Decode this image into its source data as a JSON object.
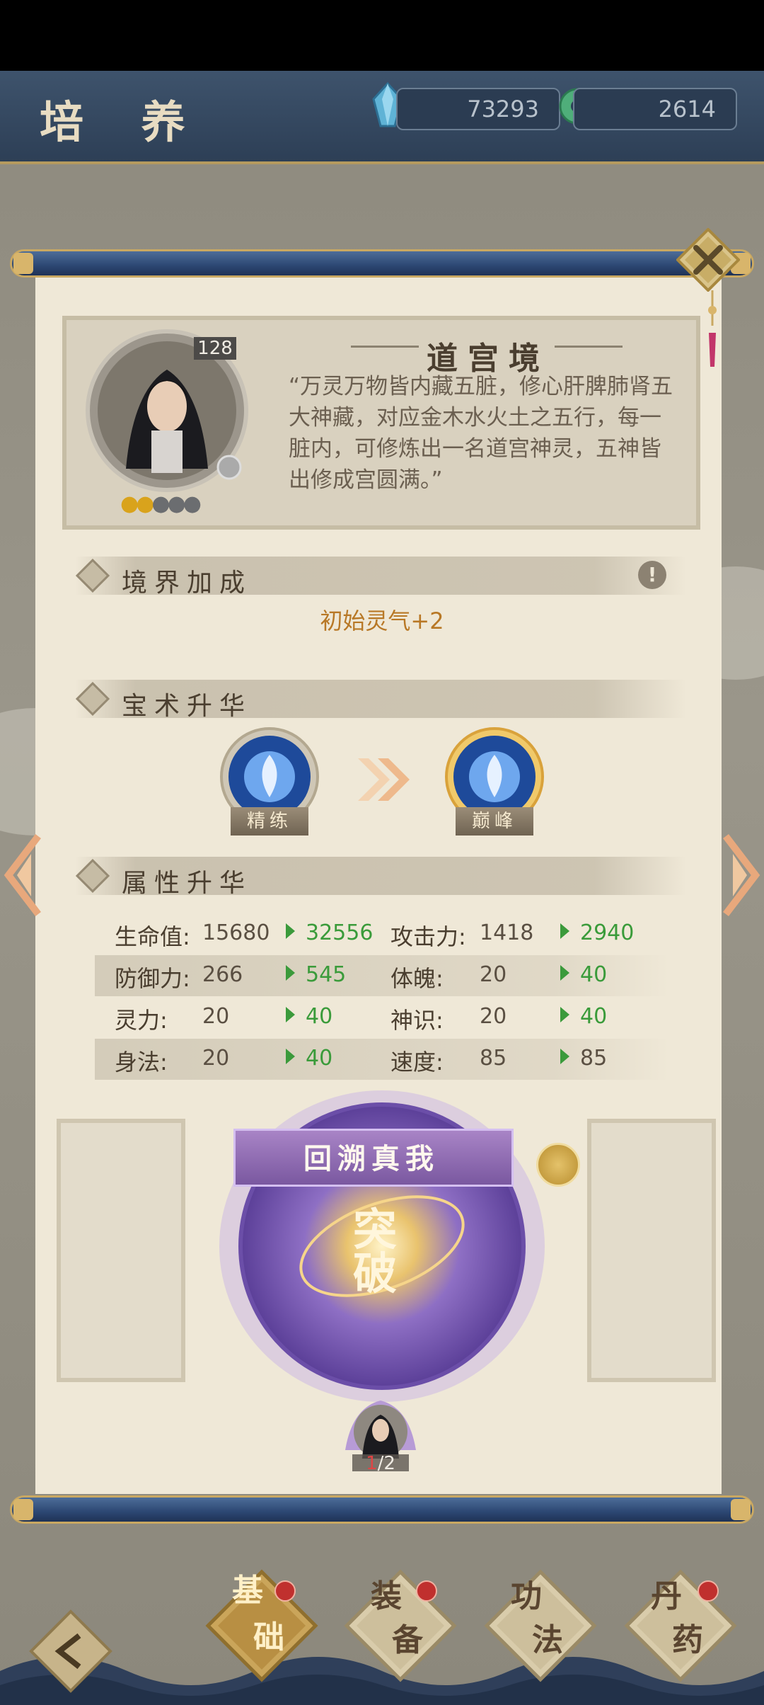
{
  "header": {
    "title": "培 养",
    "spirit_stones": "73293",
    "jade": "2614"
  },
  "hero": {
    "level": "128",
    "stars_total": 5,
    "stars_gold": 2
  },
  "realm": {
    "title": "道宫境",
    "description": "“万灵万物皆内藏五脏，修心肝脾肺肾五大神藏，对应金木水火土之五行，每一脏内，可修炼出一名道宫神灵，五神皆出修成宫圆满。”"
  },
  "sections": {
    "realm_bonus": "境界加成",
    "skill_upgrade": "宝术升华",
    "attr_upgrade": "属性升华"
  },
  "bonus_text": "初始灵气+2",
  "skills": {
    "current_tag": "精练",
    "next_tag": "巅峰"
  },
  "stats": [
    {
      "left_name": "生命值:",
      "left_val": "15680",
      "left_new": "32556",
      "right_name": "攻击力:",
      "right_val": "1418",
      "right_new": "2940"
    },
    {
      "left_name": "防御力:",
      "left_val": "266",
      "left_new": "545",
      "right_name": "体魄:",
      "right_val": "20",
      "right_new": "40"
    },
    {
      "left_name": "灵力:",
      "left_val": "20",
      "left_new": "40",
      "right_name": "神识:",
      "right_val": "20",
      "right_new": "40"
    },
    {
      "left_name": "身法:",
      "left_val": "20",
      "left_new": "40",
      "right_name": "速度:",
      "right_val": "85",
      "right_new": "85"
    }
  ],
  "breakthrough": {
    "banner": "回溯真我",
    "action": "突破",
    "progress_current": "1",
    "progress_total": "/2"
  },
  "nav": {
    "basic_1": "基",
    "basic_2": "础",
    "equip_1": "装",
    "equip_2": "备",
    "skill_1": "功",
    "skill_2": "法",
    "pill_1": "丹",
    "pill_2": "药"
  },
  "colors": {
    "accent_gold": "#c9a862",
    "increase_green": "#3a9b3a",
    "bonus_orange": "#b87826",
    "rod_blue": "#2c4772"
  }
}
